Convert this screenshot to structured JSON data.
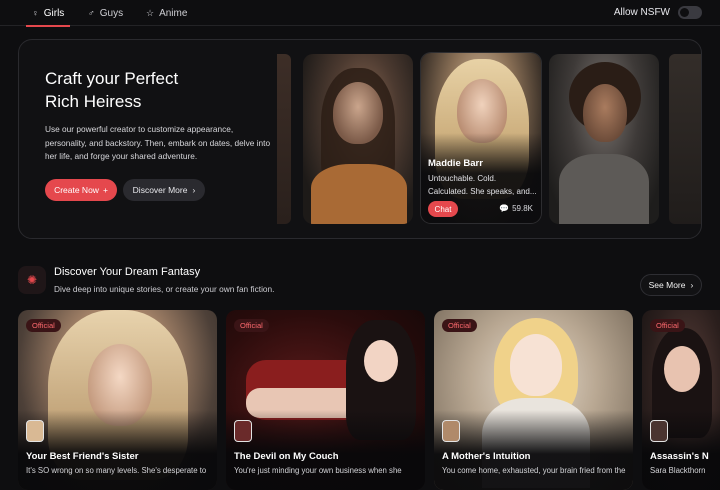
{
  "tabs": [
    {
      "label": "Girls",
      "icon": "female-icon",
      "active": true
    },
    {
      "label": "Guys",
      "icon": "male-icon",
      "active": false
    },
    {
      "label": "Anime",
      "icon": "star-icon",
      "active": false
    }
  ],
  "nsfw_toggle": {
    "label": "Allow NSFW",
    "enabled": false
  },
  "hero": {
    "title_line1": "Craft your Perfect",
    "title_line2": "Rich Heiress",
    "description": "Use our powerful creator to customize appearance, personality, and backstory. Then, embark on dates, delve into her life, and forge your shared adventure.",
    "create_label": "Create Now",
    "create_icon": "plus-icon",
    "discover_label": "Discover More",
    "discover_icon": "chevron-right-icon"
  },
  "featured_character": {
    "name": "Maddie Barr",
    "description": "Untouchable. Cold. Calculated. She speaks, and...",
    "chat_label": "Chat",
    "chat_count": "59.8K",
    "chat_count_icon": "chat-bubbles-icon"
  },
  "section": {
    "icon": "sparkle-icon",
    "title": "Discover Your Dream Fantasy",
    "subtitle": "Dive deep into unique stories, or create your own fan fiction.",
    "see_more_label": "See More",
    "see_more_icon": "chevron-right-icon"
  },
  "stories": [
    {
      "badge": "Official",
      "title": "Your Best Friend's Sister",
      "description": "It's SO wrong on so many levels. She's desperate to"
    },
    {
      "badge": "Official",
      "title": "The Devil on My Couch",
      "description": "You're just minding your own business when she"
    },
    {
      "badge": "Official",
      "title": "A Mother's Intuition",
      "description": "You come home, exhausted, your brain fried from the"
    },
    {
      "badge": "Official",
      "title": "Assassin's N",
      "description": "Sara Blackthorn"
    }
  ],
  "colors": {
    "accent": "#e5484d",
    "background": "#0e0e10",
    "card": "#111113"
  }
}
